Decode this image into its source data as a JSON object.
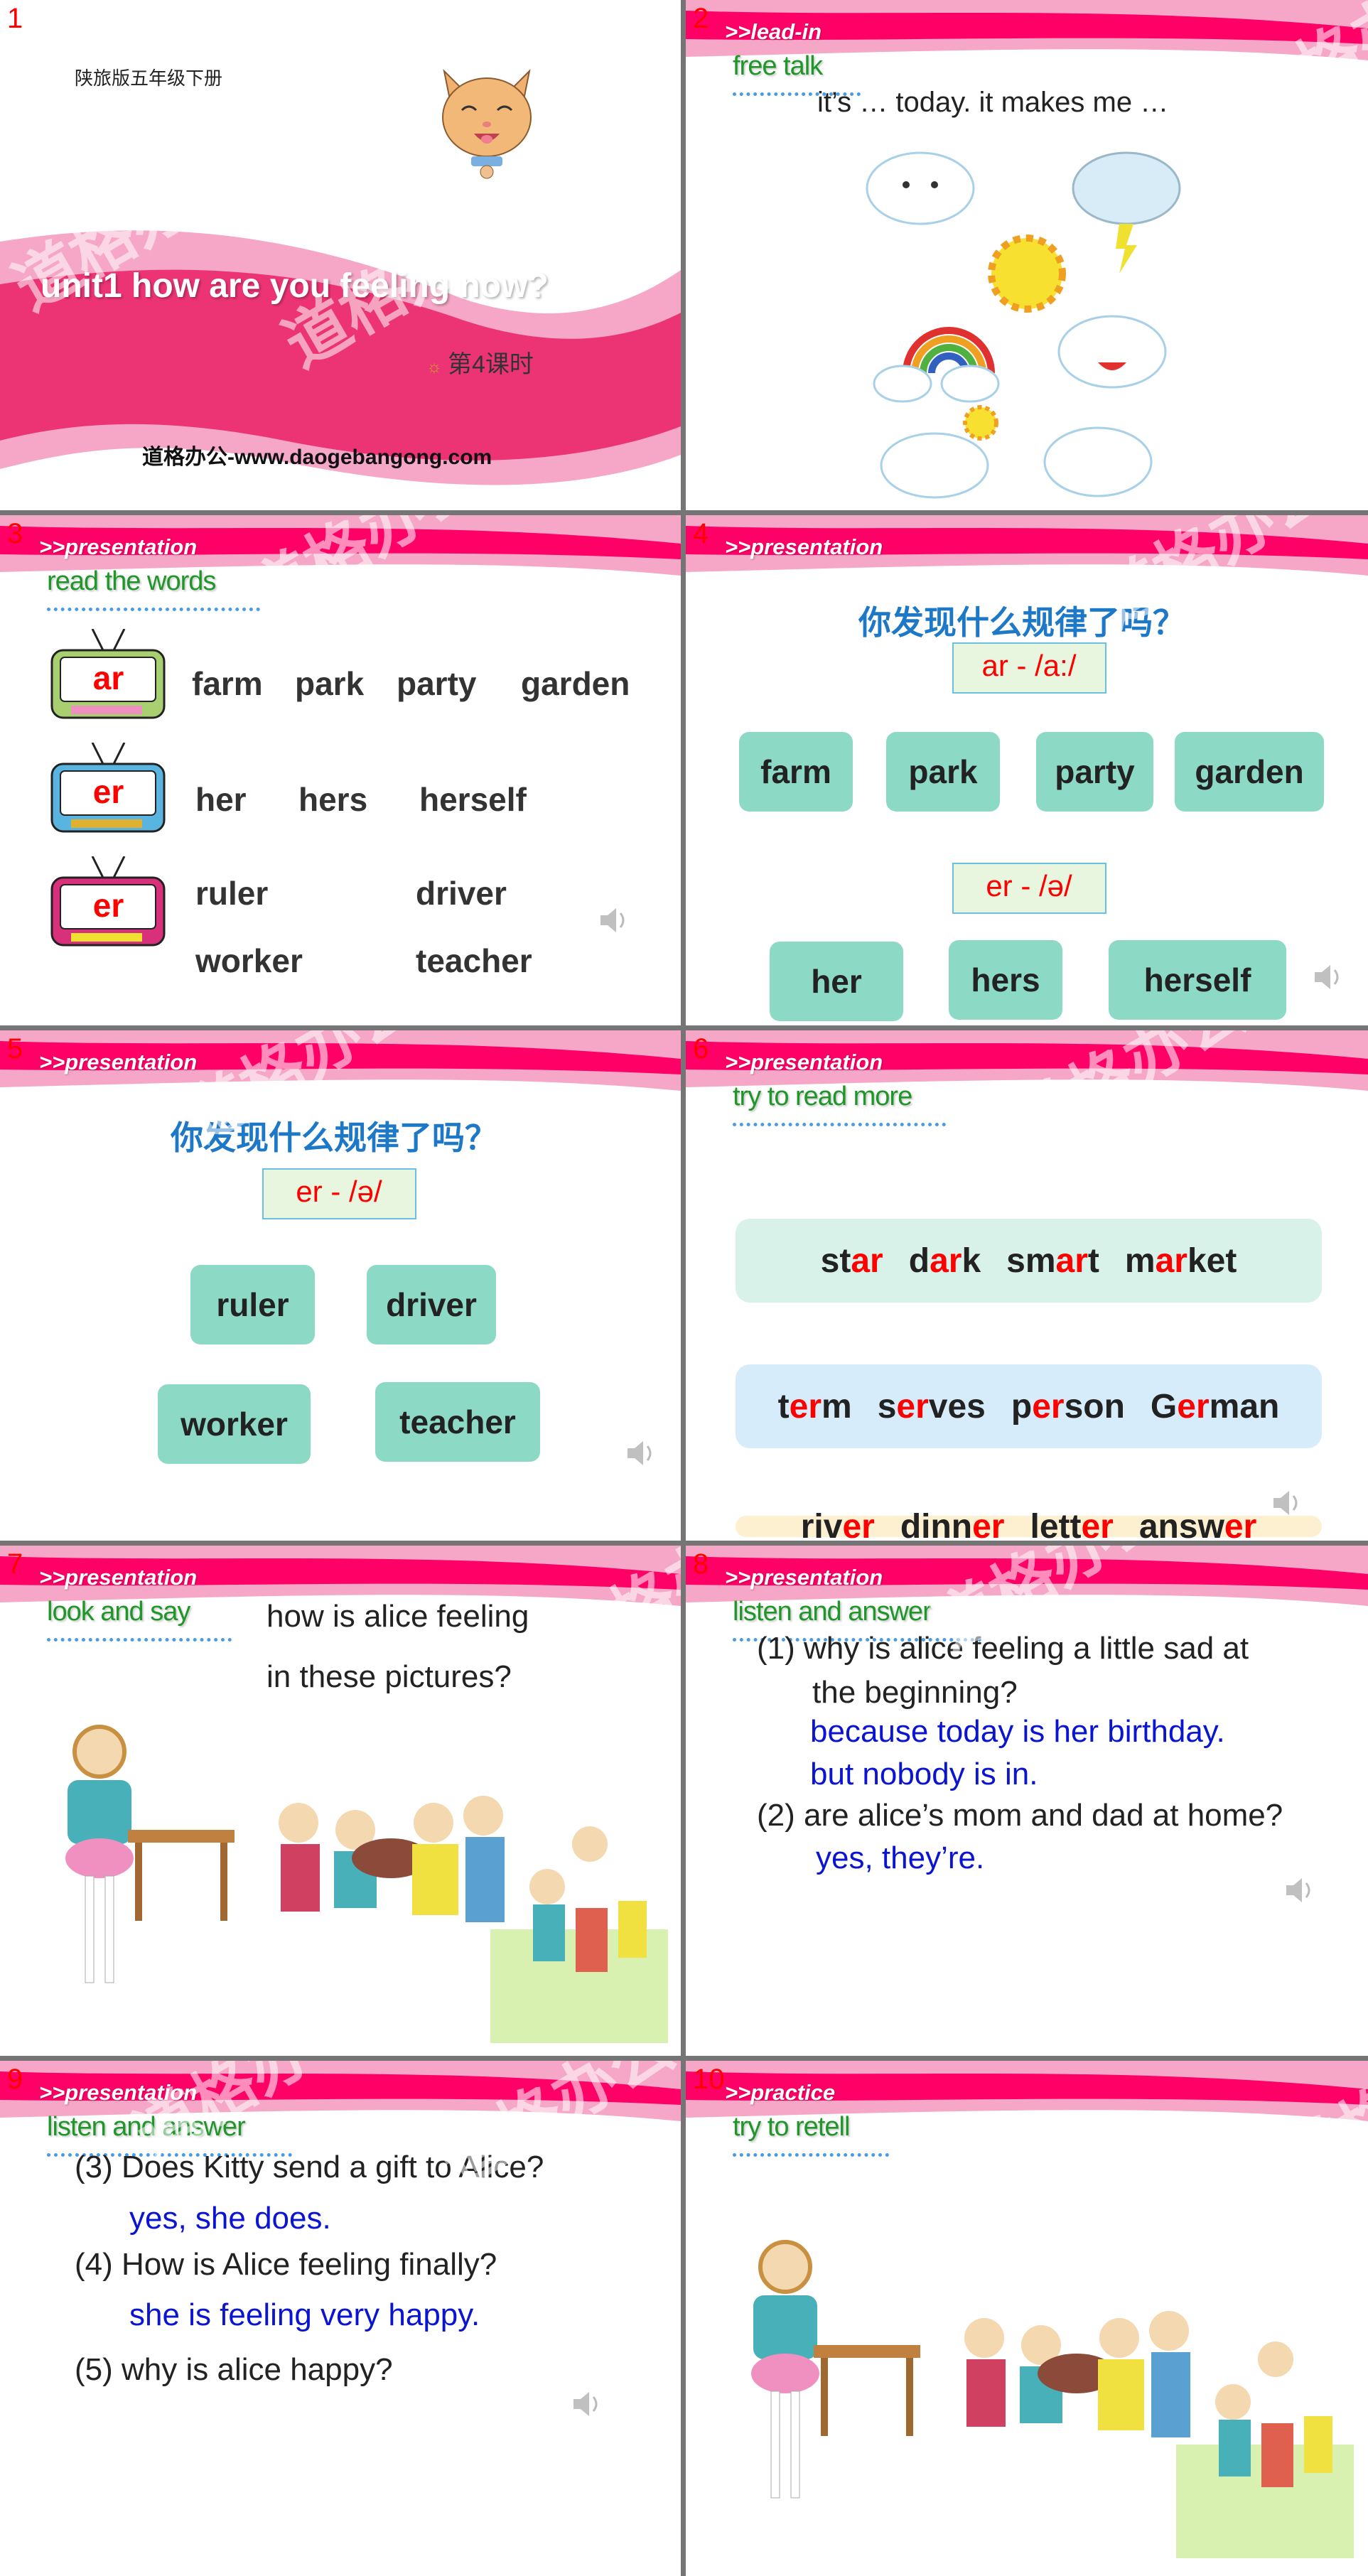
{
  "slides": [
    {
      "number": "1",
      "publisher": "陕旅版五年级下册",
      "title": "unit1 how are you feeling now?",
      "lesson": "第4课时",
      "site": "道格办公-www.daogebangong.com",
      "image": "cat-face-illustration"
    },
    {
      "number": "2",
      "section": ">>lead-in",
      "subtitle": "free talk",
      "prompt": "it’s … today. it makes me …",
      "image": "weather-icons-illustration"
    },
    {
      "number": "3",
      "section": ">>presentation",
      "subtitle": "read the words",
      "groups": [
        {
          "label": "ar",
          "tv_color": "#a8d070",
          "words": [
            "farm",
            "park",
            "party",
            "garden"
          ]
        },
        {
          "label": "er",
          "tv_color": "#5ab4e0",
          "words": [
            "her",
            "hers",
            "herself"
          ]
        },
        {
          "label": "er",
          "tv_color": "#d8307a",
          "words": [
            "ruler",
            "driver",
            "worker",
            "teacher"
          ]
        }
      ]
    },
    {
      "number": "4",
      "section": ">>presentation",
      "question": "你发现什么规律了吗？",
      "rules": [
        {
          "pattern": "ar - /a:/",
          "words": [
            "farm",
            "park",
            "party",
            "garden"
          ]
        },
        {
          "pattern": "er - /ə/",
          "words": [
            "her",
            "hers",
            "herself"
          ]
        }
      ]
    },
    {
      "number": "5",
      "section": ">>presentation",
      "question": "你发现什么规律了吗？",
      "rules": [
        {
          "pattern": "er - /ə/",
          "words": [
            "ruler",
            "driver",
            "worker",
            "teacher"
          ]
        }
      ]
    },
    {
      "number": "6",
      "section": ">>presentation",
      "subtitle": "try to read more",
      "rows": [
        {
          "bg": "#d8f2ea",
          "words": [
            {
              "pre": "st",
              "hl": "ar",
              "post": ""
            },
            {
              "pre": "d",
              "hl": "ar",
              "post": "k"
            },
            {
              "pre": "sm",
              "hl": "ar",
              "post": "t"
            },
            {
              "pre": "m",
              "hl": "ar",
              "post": "ket"
            }
          ]
        },
        {
          "bg": "#d6ecfa",
          "words": [
            {
              "pre": "t",
              "hl": "er",
              "post": "m"
            },
            {
              "pre": "s",
              "hl": "er",
              "post": "ves"
            },
            {
              "pre": "p",
              "hl": "er",
              "post": "son"
            },
            {
              "pre": "G",
              "hl": "er",
              "post": "man"
            }
          ]
        },
        {
          "bg": "#fdf0d0",
          "words": [
            {
              "pre": "riv",
              "hl": "er",
              "post": ""
            },
            {
              "pre": "dinn",
              "hl": "er",
              "post": ""
            },
            {
              "pre": "lett",
              "hl": "er",
              "post": ""
            },
            {
              "pre": "answ",
              "hl": "er",
              "post": ""
            }
          ]
        }
      ]
    },
    {
      "number": "7",
      "section": ">>presentation",
      "subtitle": "look and say",
      "question_lines": [
        "how is alice feeling",
        "in these pictures?"
      ],
      "image": "alice-birthday-story-illustration"
    },
    {
      "number": "8",
      "section": ">>presentation",
      "subtitle": "listen and answer",
      "items": [
        {
          "q": [
            "(1)  why is alice feeling a little sad at",
            "the beginning?"
          ],
          "a": [
            "because today is her birthday.",
            "but nobody is in."
          ]
        },
        {
          "q": [
            "(2) are alice’s mom and dad at home?"
          ],
          "a": [
            "yes, they’re."
          ]
        }
      ]
    },
    {
      "number": "9",
      "section": ">>presentation",
      "subtitle": "listen and answer",
      "items": [
        {
          "q": [
            "(3) Does Kitty send a gift to Alice?"
          ],
          "a": [
            "yes, she does."
          ]
        },
        {
          "q": [
            "(4) How is Alice feeling finally?"
          ],
          "a": [
            "she is feeling very happy."
          ]
        },
        {
          "q": [
            "(5) why is alice happy?"
          ],
          "a": []
        }
      ]
    },
    {
      "number": "10",
      "section": ">>practice",
      "subtitle": "try to retell",
      "image": "alice-birthday-story-illustration"
    }
  ],
  "watermark": "道格办公",
  "colors": {
    "band_main": "#ff0066",
    "band_light": "#f6a6c6",
    "title_band": "#ec3474",
    "subtitle_green": "#1e9628",
    "highlight_red": "#ff0000",
    "answer_blue": "#0a14d2",
    "tile_teal": "#8cdac6",
    "grid_gray": "#757575"
  }
}
